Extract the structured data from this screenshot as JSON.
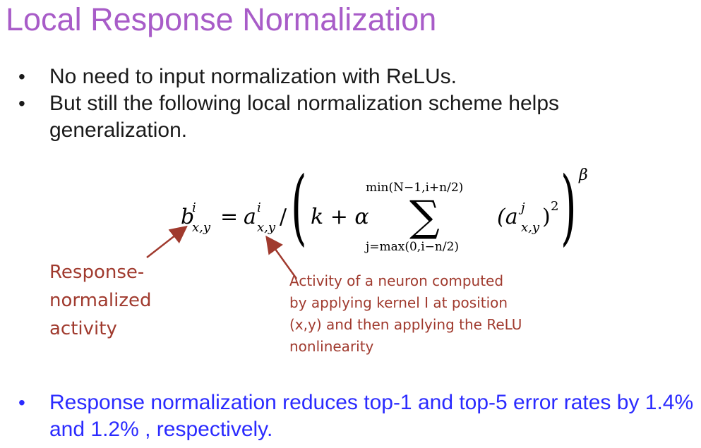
{
  "slide": {
    "title": "Local Response Normalization",
    "bullets": [
      "No need to input normalization with ReLUs.",
      "But still the following local normalization scheme helps generalization."
    ],
    "formula": {
      "lhs_base": "b",
      "lhs_sup": "i",
      "lhs_sub": "x,y",
      "equals": "=",
      "rhs_base": "a",
      "rhs_sup": "i",
      "rhs_sub": "x,y",
      "slash": "/",
      "k_alpha": "k + α",
      "sum_upper": "min(N−1,i+n/2)",
      "sum_sign": "∑",
      "sum_lower": "j=max(0,i−n/2)",
      "term_open": "(a",
      "term_sup": "j",
      "term_sub": "x,y",
      "term_close": ")",
      "term_sq": "2",
      "beta": "β",
      "paren_open": "(",
      "paren_close": ")"
    },
    "annotation_left": [
      "Response-",
      "normalized",
      "activity"
    ],
    "annotation_right": [
      "Activity of a neuron computed",
      "by applying kernel I at position",
      "(x,y) and then applying the ReLU",
      "nonlinearity"
    ],
    "bottom_bullet": "Response normalization reduces top-1 and top-5  error rates by 1.4% and 1.2% , respectively.",
    "bullet_glyph": "•",
    "colors": {
      "title": "#a85cc8",
      "annotation": "#a03a2e",
      "bottom_bullet": "#2b2bff",
      "text": "#1a1a1a"
    }
  }
}
